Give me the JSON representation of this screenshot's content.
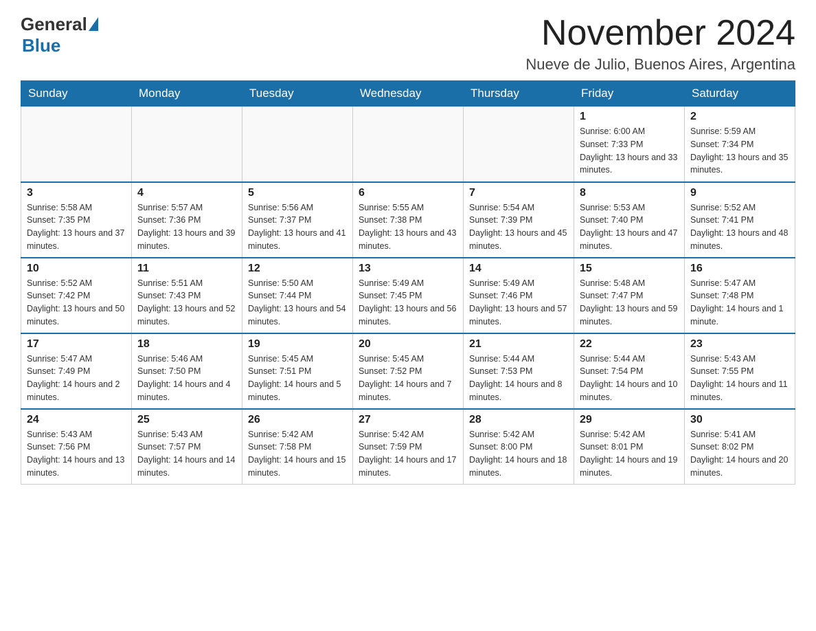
{
  "logo": {
    "general": "General",
    "blue": "Blue"
  },
  "title": "November 2024",
  "location": "Nueve de Julio, Buenos Aires, Argentina",
  "weekdays": [
    "Sunday",
    "Monday",
    "Tuesday",
    "Wednesday",
    "Thursday",
    "Friday",
    "Saturday"
  ],
  "weeks": [
    [
      {
        "day": "",
        "sunrise": "",
        "sunset": "",
        "daylight": ""
      },
      {
        "day": "",
        "sunrise": "",
        "sunset": "",
        "daylight": ""
      },
      {
        "day": "",
        "sunrise": "",
        "sunset": "",
        "daylight": ""
      },
      {
        "day": "",
        "sunrise": "",
        "sunset": "",
        "daylight": ""
      },
      {
        "day": "",
        "sunrise": "",
        "sunset": "",
        "daylight": ""
      },
      {
        "day": "1",
        "sunrise": "Sunrise: 6:00 AM",
        "sunset": "Sunset: 7:33 PM",
        "daylight": "Daylight: 13 hours and 33 minutes."
      },
      {
        "day": "2",
        "sunrise": "Sunrise: 5:59 AM",
        "sunset": "Sunset: 7:34 PM",
        "daylight": "Daylight: 13 hours and 35 minutes."
      }
    ],
    [
      {
        "day": "3",
        "sunrise": "Sunrise: 5:58 AM",
        "sunset": "Sunset: 7:35 PM",
        "daylight": "Daylight: 13 hours and 37 minutes."
      },
      {
        "day": "4",
        "sunrise": "Sunrise: 5:57 AM",
        "sunset": "Sunset: 7:36 PM",
        "daylight": "Daylight: 13 hours and 39 minutes."
      },
      {
        "day": "5",
        "sunrise": "Sunrise: 5:56 AM",
        "sunset": "Sunset: 7:37 PM",
        "daylight": "Daylight: 13 hours and 41 minutes."
      },
      {
        "day": "6",
        "sunrise": "Sunrise: 5:55 AM",
        "sunset": "Sunset: 7:38 PM",
        "daylight": "Daylight: 13 hours and 43 minutes."
      },
      {
        "day": "7",
        "sunrise": "Sunrise: 5:54 AM",
        "sunset": "Sunset: 7:39 PM",
        "daylight": "Daylight: 13 hours and 45 minutes."
      },
      {
        "day": "8",
        "sunrise": "Sunrise: 5:53 AM",
        "sunset": "Sunset: 7:40 PM",
        "daylight": "Daylight: 13 hours and 47 minutes."
      },
      {
        "day": "9",
        "sunrise": "Sunrise: 5:52 AM",
        "sunset": "Sunset: 7:41 PM",
        "daylight": "Daylight: 13 hours and 48 minutes."
      }
    ],
    [
      {
        "day": "10",
        "sunrise": "Sunrise: 5:52 AM",
        "sunset": "Sunset: 7:42 PM",
        "daylight": "Daylight: 13 hours and 50 minutes."
      },
      {
        "day": "11",
        "sunrise": "Sunrise: 5:51 AM",
        "sunset": "Sunset: 7:43 PM",
        "daylight": "Daylight: 13 hours and 52 minutes."
      },
      {
        "day": "12",
        "sunrise": "Sunrise: 5:50 AM",
        "sunset": "Sunset: 7:44 PM",
        "daylight": "Daylight: 13 hours and 54 minutes."
      },
      {
        "day": "13",
        "sunrise": "Sunrise: 5:49 AM",
        "sunset": "Sunset: 7:45 PM",
        "daylight": "Daylight: 13 hours and 56 minutes."
      },
      {
        "day": "14",
        "sunrise": "Sunrise: 5:49 AM",
        "sunset": "Sunset: 7:46 PM",
        "daylight": "Daylight: 13 hours and 57 minutes."
      },
      {
        "day": "15",
        "sunrise": "Sunrise: 5:48 AM",
        "sunset": "Sunset: 7:47 PM",
        "daylight": "Daylight: 13 hours and 59 minutes."
      },
      {
        "day": "16",
        "sunrise": "Sunrise: 5:47 AM",
        "sunset": "Sunset: 7:48 PM",
        "daylight": "Daylight: 14 hours and 1 minute."
      }
    ],
    [
      {
        "day": "17",
        "sunrise": "Sunrise: 5:47 AM",
        "sunset": "Sunset: 7:49 PM",
        "daylight": "Daylight: 14 hours and 2 minutes."
      },
      {
        "day": "18",
        "sunrise": "Sunrise: 5:46 AM",
        "sunset": "Sunset: 7:50 PM",
        "daylight": "Daylight: 14 hours and 4 minutes."
      },
      {
        "day": "19",
        "sunrise": "Sunrise: 5:45 AM",
        "sunset": "Sunset: 7:51 PM",
        "daylight": "Daylight: 14 hours and 5 minutes."
      },
      {
        "day": "20",
        "sunrise": "Sunrise: 5:45 AM",
        "sunset": "Sunset: 7:52 PM",
        "daylight": "Daylight: 14 hours and 7 minutes."
      },
      {
        "day": "21",
        "sunrise": "Sunrise: 5:44 AM",
        "sunset": "Sunset: 7:53 PM",
        "daylight": "Daylight: 14 hours and 8 minutes."
      },
      {
        "day": "22",
        "sunrise": "Sunrise: 5:44 AM",
        "sunset": "Sunset: 7:54 PM",
        "daylight": "Daylight: 14 hours and 10 minutes."
      },
      {
        "day": "23",
        "sunrise": "Sunrise: 5:43 AM",
        "sunset": "Sunset: 7:55 PM",
        "daylight": "Daylight: 14 hours and 11 minutes."
      }
    ],
    [
      {
        "day": "24",
        "sunrise": "Sunrise: 5:43 AM",
        "sunset": "Sunset: 7:56 PM",
        "daylight": "Daylight: 14 hours and 13 minutes."
      },
      {
        "day": "25",
        "sunrise": "Sunrise: 5:43 AM",
        "sunset": "Sunset: 7:57 PM",
        "daylight": "Daylight: 14 hours and 14 minutes."
      },
      {
        "day": "26",
        "sunrise": "Sunrise: 5:42 AM",
        "sunset": "Sunset: 7:58 PM",
        "daylight": "Daylight: 14 hours and 15 minutes."
      },
      {
        "day": "27",
        "sunrise": "Sunrise: 5:42 AM",
        "sunset": "Sunset: 7:59 PM",
        "daylight": "Daylight: 14 hours and 17 minutes."
      },
      {
        "day": "28",
        "sunrise": "Sunrise: 5:42 AM",
        "sunset": "Sunset: 8:00 PM",
        "daylight": "Daylight: 14 hours and 18 minutes."
      },
      {
        "day": "29",
        "sunrise": "Sunrise: 5:42 AM",
        "sunset": "Sunset: 8:01 PM",
        "daylight": "Daylight: 14 hours and 19 minutes."
      },
      {
        "day": "30",
        "sunrise": "Sunrise: 5:41 AM",
        "sunset": "Sunset: 8:02 PM",
        "daylight": "Daylight: 14 hours and 20 minutes."
      }
    ]
  ]
}
